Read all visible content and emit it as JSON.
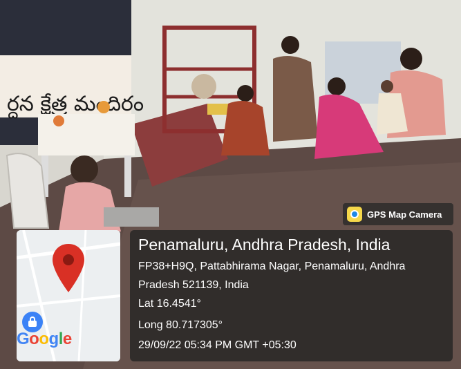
{
  "photo": {
    "description_icons": [
      "pin-icon",
      "camera-icon",
      "lock-icon"
    ],
    "banner_text": "ర్దన క్షేత్ర మందిరం"
  },
  "badge": {
    "label": "GPS Map Camera",
    "icon": "camera-icon"
  },
  "map": {
    "logo_letters": [
      "G",
      "o",
      "o",
      "g",
      "l",
      "e"
    ],
    "logo_colors": [
      "#4285F4",
      "#EA4335",
      "#FBBC05",
      "#4285F4",
      "#34A853",
      "#EA4335"
    ],
    "pin_color": "#d93025"
  },
  "info": {
    "title": "Penamaluru, Andhra Pradesh, India",
    "address_line1": "FP38+H9Q, Pattabhirama Nagar, Penamaluru, Andhra",
    "address_line2": "Pradesh 521139, India",
    "lat": "Lat 16.4541°",
    "long": "Long 80.717305°",
    "datetime": "29/09/22 05:34 PM GMT +05:30"
  }
}
